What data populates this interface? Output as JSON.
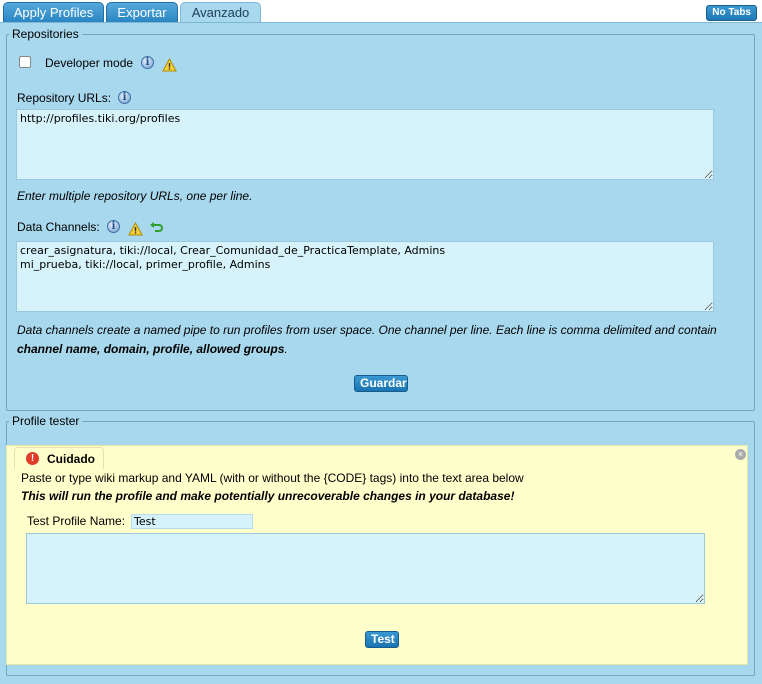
{
  "tabs": [
    {
      "label": "Apply Profiles",
      "active": false
    },
    {
      "label": "Exportar",
      "active": false
    },
    {
      "label": "Avanzado",
      "active": true
    }
  ],
  "no_tabs_label": "No Tabs",
  "repositories": {
    "legend": "Repositories",
    "developer_mode_label": "Developer mode",
    "developer_mode_checked": false,
    "repository_urls_label": "Repository URLs:",
    "repository_urls_value": "http://profiles.tiki.org/profiles",
    "repository_urls_help": "Enter multiple repository URLs, one per line.",
    "data_channels_label": "Data Channels:",
    "data_channels_value": "crear_asignatura, tiki://local, Crear_Comunidad_de_PracticaTemplate, Admins\nmi_prueba, tiki://local, primer_profile, Admins",
    "data_channels_help": "Data channels create a named pipe to run profiles from user space. One channel per line. Each line is comma delimited and contain",
    "data_channels_help_bold": "channel name, domain, profile, allowed groups",
    "data_channels_help_end": ".",
    "save_button": "Guardar"
  },
  "profile_tester": {
    "legend": "Profile tester",
    "warning_title": "Cuidado",
    "warning_line1": "Paste or type wiki markup and YAML (with or without the {CODE} tags) into the text area below",
    "warning_line2": "This will run the profile and make potentially unrecoverable changes in your database!",
    "test_name_label": "Test Profile Name:",
    "test_name_value": "Test",
    "test_content_value": "",
    "test_button": "Test"
  },
  "colors": {
    "panel_bg": "#a8d8ed",
    "tab_blue": "#2a86c2",
    "warning_bg": "#ffffcc",
    "input_bg": "#d6f2fa"
  }
}
